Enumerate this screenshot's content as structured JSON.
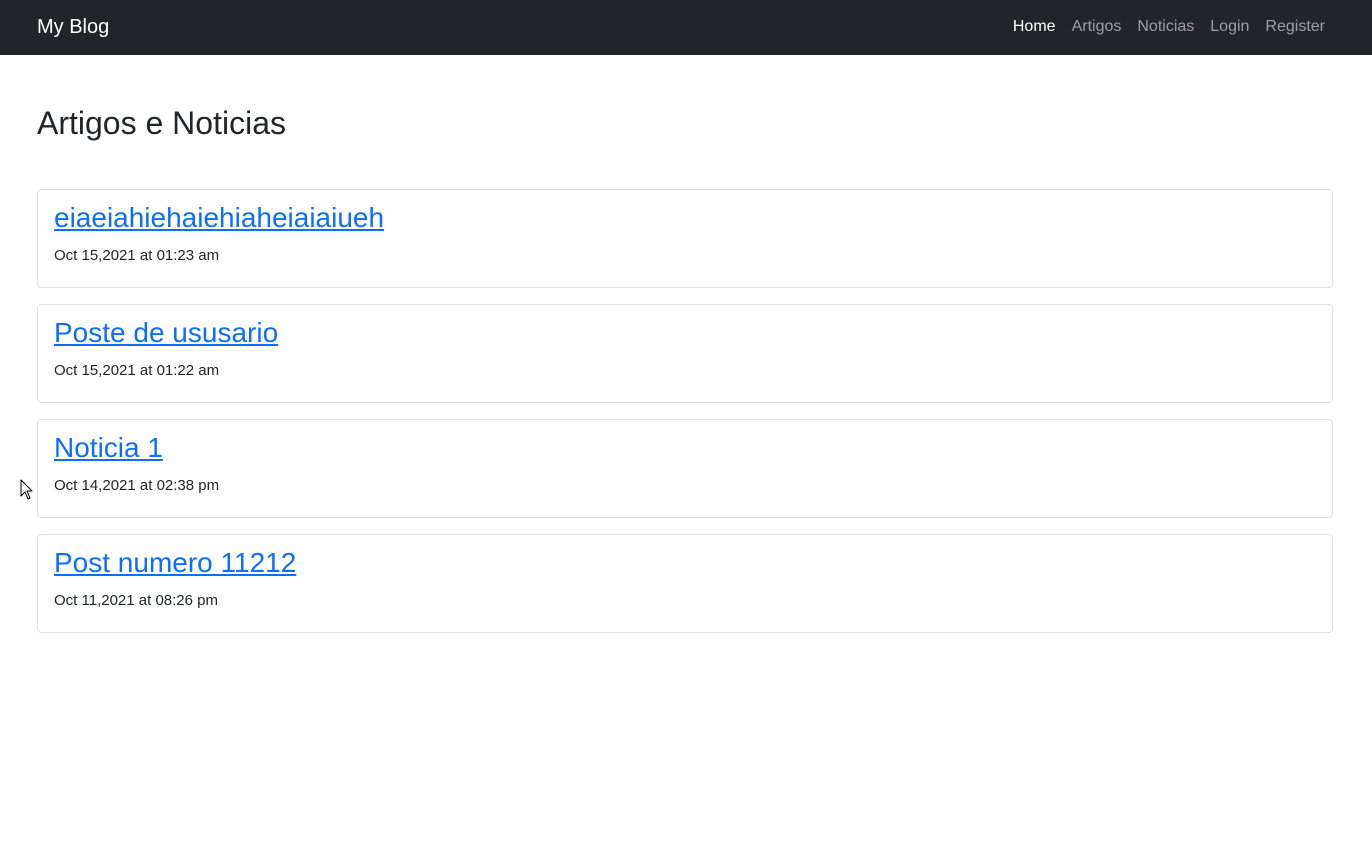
{
  "navbar": {
    "brand": "My Blog",
    "links": [
      {
        "label": "Home",
        "active": true
      },
      {
        "label": "Artigos",
        "active": false
      },
      {
        "label": "Noticias",
        "active": false
      },
      {
        "label": "Login",
        "active": false
      },
      {
        "label": "Register",
        "active": false
      }
    ]
  },
  "main": {
    "title": "Artigos e Noticias",
    "posts": [
      {
        "title": "eiaeiahiehaiehiaheiaiaiueh",
        "date": "Oct 15,2021 at 01:23 am"
      },
      {
        "title": "Poste de ususario",
        "date": "Oct 15,2021 at 01:22 am"
      },
      {
        "title": "Noticia 1",
        "date": "Oct 14,2021 at 02:38 pm"
      },
      {
        "title": "Post numero 11212",
        "date": "Oct 11,2021 at 08:26 pm"
      }
    ]
  },
  "colors": {
    "navbar_bg": "#212529",
    "link_blue": "#0d6efd",
    "border": "#dee2e6"
  },
  "icons": {
    "cursor": "mouse-pointer-icon"
  }
}
